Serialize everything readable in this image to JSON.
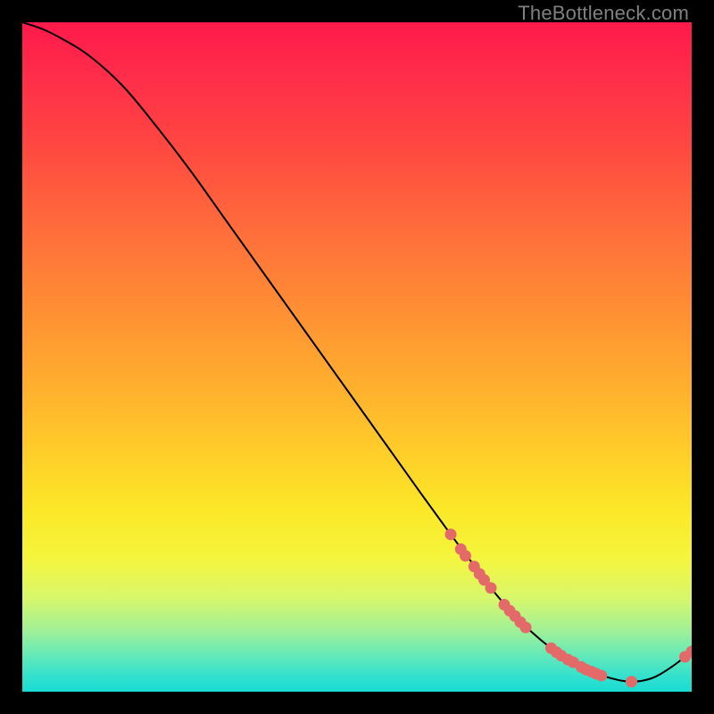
{
  "watermark": "TheBottleneck.com",
  "colors": {
    "page_bg": "#000000",
    "curve": "#000000",
    "marker_fill": "#e46a6a",
    "marker_stroke": "#c94f4f",
    "watermark": "#808080"
  },
  "chart_data": {
    "type": "line",
    "title": "",
    "xlabel": "",
    "ylabel": "",
    "xlim": [
      0,
      100
    ],
    "ylim": [
      0,
      100
    ],
    "series": [
      {
        "name": "curve",
        "x": [
          0,
          3,
          6,
          10,
          15,
          20,
          25,
          30,
          35,
          40,
          45,
          50,
          55,
          60,
          64,
          67,
          70,
          73,
          76,
          79,
          82,
          85,
          88,
          91,
          94,
          97,
          100
        ],
        "y": [
          100,
          99,
          97.5,
          95,
          90.5,
          84.5,
          78,
          71,
          64,
          57,
          50,
          43,
          36,
          29,
          23.5,
          19.5,
          15.5,
          12,
          9,
          6.5,
          4.5,
          3,
          2,
          1.5,
          2,
          3.7,
          6
        ]
      }
    ],
    "markers": [
      {
        "x": 64.0,
        "y": 23.5
      },
      {
        "x": 65.5,
        "y": 21.3
      },
      {
        "x": 66.2,
        "y": 20.3
      },
      {
        "x": 67.5,
        "y": 18.7
      },
      {
        "x": 68.3,
        "y": 17.6
      },
      {
        "x": 69.0,
        "y": 16.7
      },
      {
        "x": 70.0,
        "y": 15.5
      },
      {
        "x": 72.0,
        "y": 13.0
      },
      {
        "x": 72.8,
        "y": 12.1
      },
      {
        "x": 73.6,
        "y": 11.3
      },
      {
        "x": 74.4,
        "y": 10.4
      },
      {
        "x": 75.2,
        "y": 9.6
      },
      {
        "x": 79.0,
        "y": 6.5
      },
      {
        "x": 79.8,
        "y": 5.9
      },
      {
        "x": 80.5,
        "y": 5.4
      },
      {
        "x": 81.5,
        "y": 4.8
      },
      {
        "x": 82.3,
        "y": 4.4
      },
      {
        "x": 83.5,
        "y": 3.7
      },
      {
        "x": 84.2,
        "y": 3.3
      },
      {
        "x": 85.0,
        "y": 3.0
      },
      {
        "x": 85.7,
        "y": 2.7
      },
      {
        "x": 86.5,
        "y": 2.4
      },
      {
        "x": 91.0,
        "y": 1.5
      },
      {
        "x": 99.0,
        "y": 5.2
      },
      {
        "x": 100.0,
        "y": 6.0
      }
    ]
  }
}
